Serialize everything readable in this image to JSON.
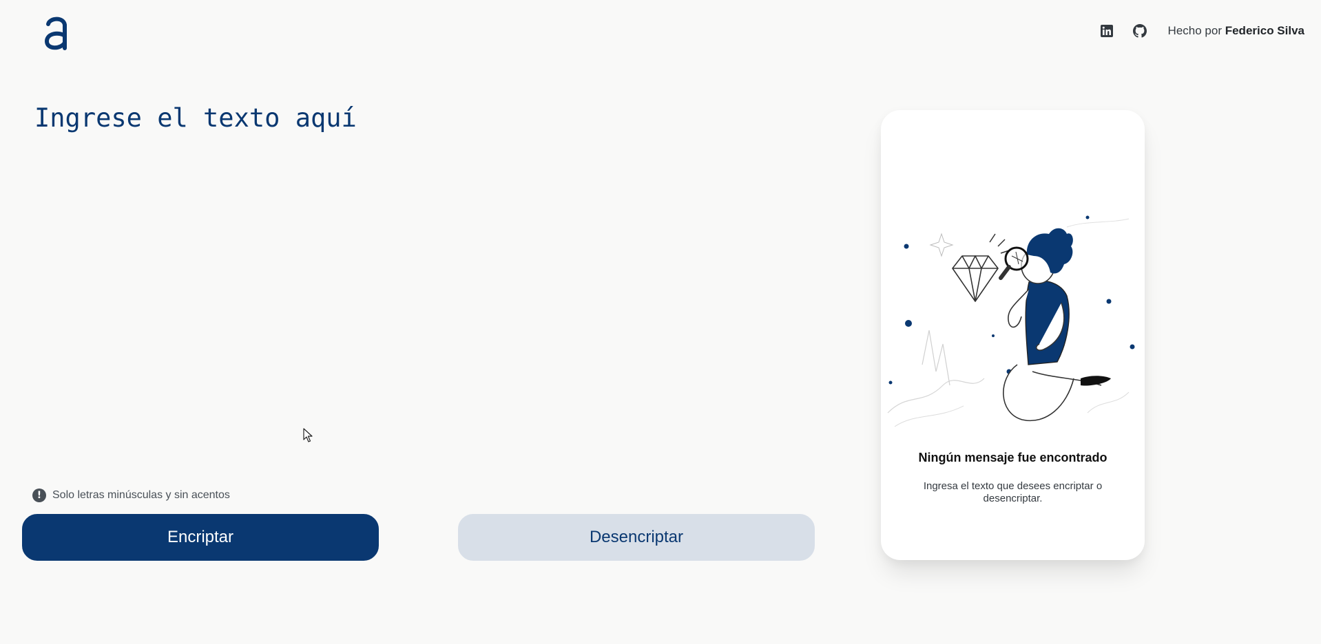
{
  "header": {
    "logo_icon": "alura-a-logo-icon",
    "linkedin_icon": "linkedin-icon",
    "github_icon": "github-icon",
    "credit_prefix": "Hecho por",
    "credit_name": "Federico Silva"
  },
  "editor": {
    "placeholder": "Ingrese el texto aquí",
    "value": ""
  },
  "hint": {
    "icon": "exclamation-circle-icon",
    "text": "Solo letras minúsculas y sin acentos"
  },
  "buttons": {
    "encrypt_label": "Encriptar",
    "decrypt_label": "Desencriptar"
  },
  "output_card": {
    "illustration": "person-with-magnifier-diamond-illustration",
    "title": "Ningún mensaje fue encontrado",
    "text": "Ingresa el texto que desees encriptar o desencriptar."
  },
  "colors": {
    "primary": "#0a3871",
    "secondary": "#d8dfe8",
    "background": "#f9f9f8",
    "card": "#ffffff"
  }
}
